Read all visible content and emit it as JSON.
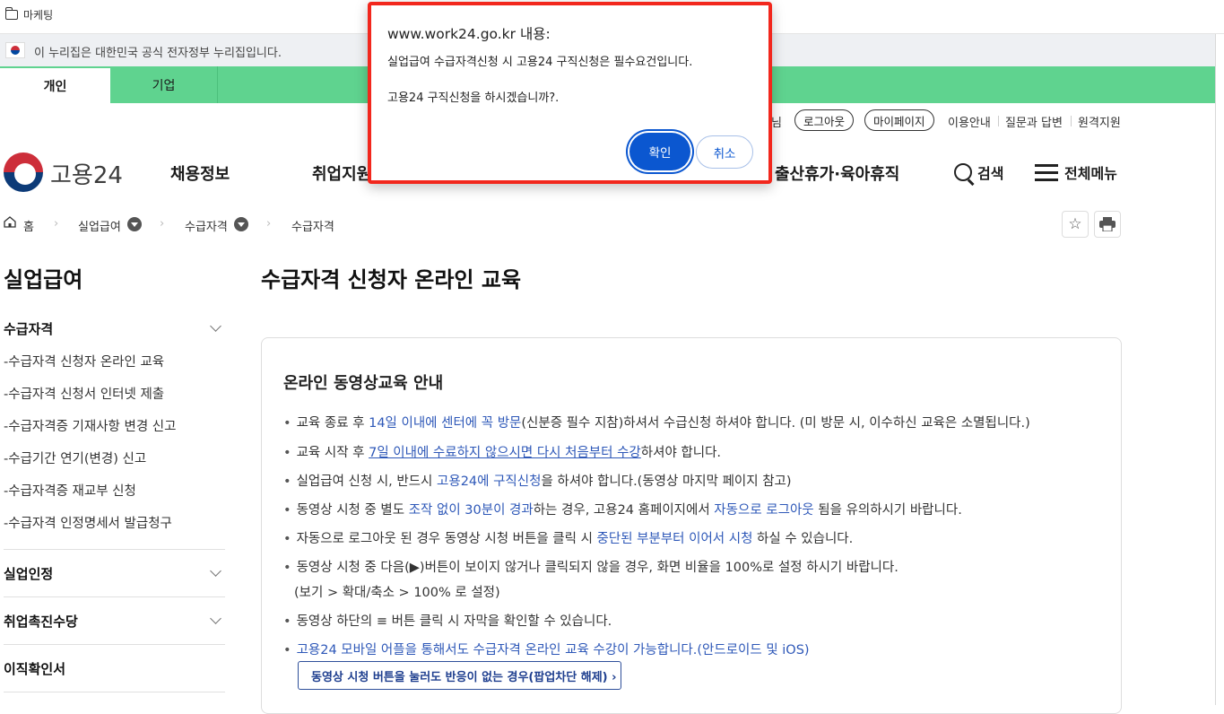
{
  "bookmarks": {
    "folder_label": "마케팅"
  },
  "gov_banner": {
    "text": "이 누리집은 대한민국 공식 전자정부 누리집입니다."
  },
  "audience_tabs": [
    {
      "label": "개인"
    },
    {
      "label": "기업"
    }
  ],
  "utility": {
    "greeting_suffix": "님",
    "logout": "로그아웃",
    "mypage": "마이페이지",
    "guide": "이용안내",
    "faq": "질문과 답변",
    "remote": "원격지원"
  },
  "header": {
    "logo_text": "고용24",
    "nav": [
      "채용정보",
      "취업지원",
      "출산휴가·육아휴직"
    ],
    "search": "검색",
    "all_menu": "전체메뉴"
  },
  "breadcrumb": {
    "home": "홈",
    "level1": "실업급여",
    "level2": "수급자격",
    "level3": "수급자격"
  },
  "sidebar": {
    "title": "실업급여",
    "sections": [
      {
        "label": "수급자격",
        "items": [
          "-수급자격 신청자 온라인 교육",
          "-수급자격 신청서 인터넷 제출",
          "-수급자격증 기재사항 변경 신고",
          "-수급기간 연기(변경) 신고",
          "-수급자격증 재교부 신청",
          "-수급자격 인정명세서 발급청구"
        ]
      },
      {
        "label": "실업인정"
      },
      {
        "label": "취업촉진수당"
      },
      {
        "label": "이직확인서"
      }
    ]
  },
  "main": {
    "page_title": "수급자격 신청자 온라인 교육",
    "box_title": "온라인 동영상교육 안내",
    "bullet": "•",
    "lines": [
      {
        "a": "교육 종료 후 ",
        "b": "14일 이내에 센터에 꼭 방문",
        "c": "(신분증 필수 지참)하셔서 수급신청 하셔야 합니다. (미 방문 시, 이수하신 교육은 소멸됩니다.)"
      },
      {
        "a": "교육 시작 후 ",
        "b": "7일 이내에 수료하지 않으시면 다시 처음부터 수강",
        "c": "하셔야 합니다."
      },
      {
        "a": "실업급여 신청 시, 반드시 ",
        "b": "고용24에 구직신청",
        "c": "을 하셔야 합니다.(동영상 마지막 페이지 참고)"
      },
      {
        "a": "동영상 시청 중 별도 ",
        "b": "조작 없이 30분이 경과",
        "c": "하는 경우, 고용24 홈페이지에서 ",
        "d": "자동으로 로그아웃",
        "e": " 됨을 유의하시기 바랍니다."
      },
      {
        "a": "자동으로 로그아웃 된 경우 동영상 시청 버튼을 클릭 시 ",
        "b": "중단된 부분부터 이어서 시청",
        "c": " 하실 수 있습니다."
      },
      {
        "a": "동영상 시청 중 다음(▶)버튼이 보이지 않거나 클릭되지 않을 경우, 화면 비율을 100%로 설정 하시기 바랍니다.",
        "sub": "(보기 > 확대/축소 > 100% 로 설정)"
      },
      {
        "a": "동영상 하단의 ≡ 버튼 클릭 시 자막을 확인할 수 있습니다."
      },
      {
        "a": "고용24 모바일 어플을 통해서도 수급자격 온라인 교육 수강이 가능합니다.(안드로이드 및 iOS)"
      }
    ],
    "popup_button": "동영상 시청 버튼을 눌러도 반응이 없는 경우(팝업차단 해제)  ›"
  },
  "dialog": {
    "origin": "www.work24.go.kr 내용:",
    "message1": "실업급여 수급자격신청 시 고용24 구직신청은 필수요건입니다.",
    "message2": "고용24 구직신청을 하시겠습니까?.",
    "ok": "확인",
    "cancel": "취소"
  },
  "colors": {
    "accent_green": "#5fd38f",
    "link_blue": "#2e58b8",
    "dialog_border": "#f2271d",
    "dialog_ok": "#0b57d0"
  }
}
